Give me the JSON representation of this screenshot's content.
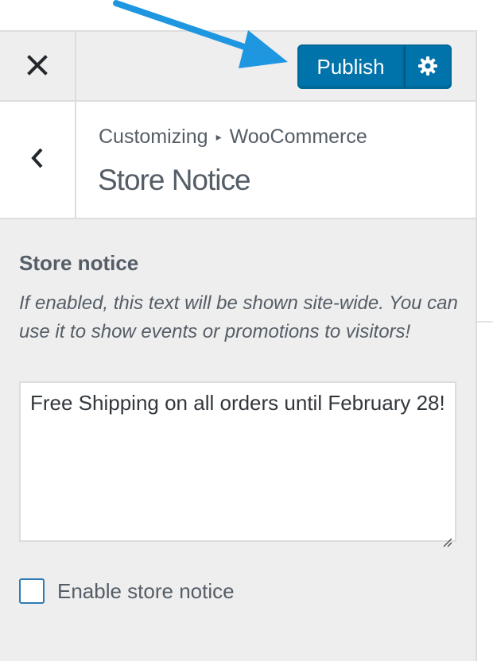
{
  "header": {
    "close_icon": "close-icon",
    "publish_label": "Publish",
    "settings_icon": "gear-icon"
  },
  "section": {
    "back_icon": "chevron-left-icon",
    "breadcrumb": {
      "root": "Customizing",
      "separator_icon": "triangle-right-icon",
      "current": "WooCommerce"
    },
    "title": "Store Notice"
  },
  "control": {
    "heading": "Store notice",
    "description": "If enabled, this text will be shown site-wide. You can use it to show events or promotions to visitors!",
    "textarea_value": "Free Shipping on all orders until February 28!",
    "checkbox_label": "Enable store notice",
    "checkbox_checked": false
  },
  "colors": {
    "accent": "#0073aa",
    "annotation_arrow": "#1e96e0",
    "panel_bg": "#eeeeee",
    "text": "#555d66"
  }
}
